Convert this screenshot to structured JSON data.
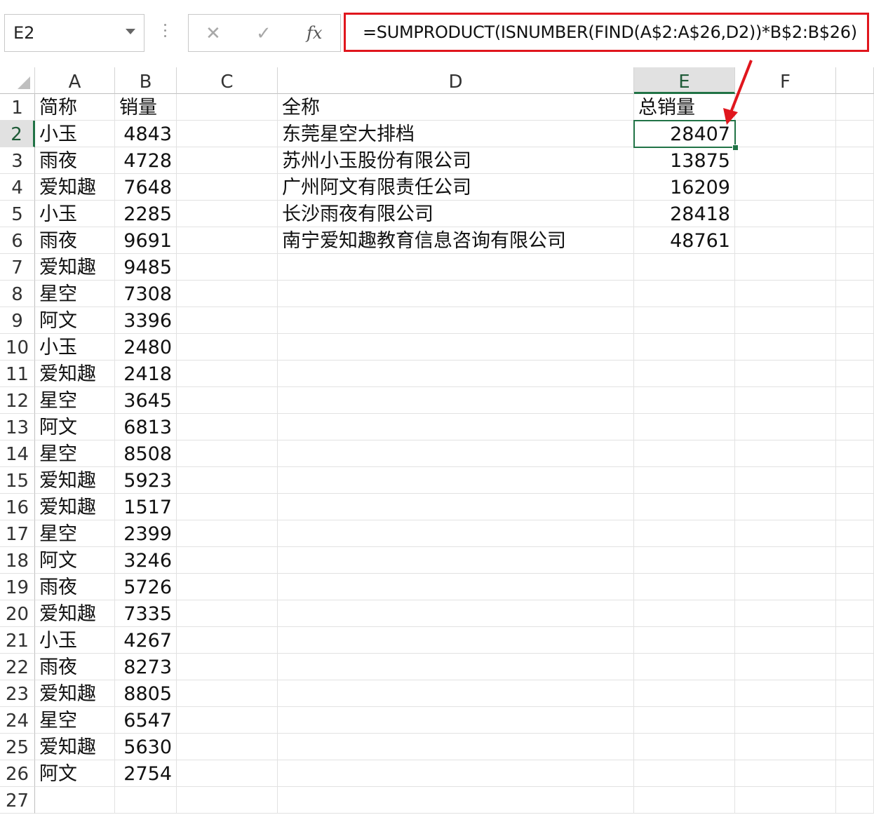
{
  "toolbar": {
    "name_box": "E2",
    "cancel_icon": "✕",
    "enter_icon": "✓",
    "function_icon": "fx",
    "formula": "=SUMPRODUCT(ISNUMBER(FIND(A$2:A$26,D2))*B$2:B$26)"
  },
  "columns": [
    "A",
    "B",
    "C",
    "D",
    "E",
    "F"
  ],
  "selected_cell": {
    "column": "E",
    "row": 2
  },
  "rows": [
    {
      "n": "1",
      "A": "简称",
      "B": "销量",
      "D": "全称",
      "E": "总销量"
    },
    {
      "n": "2",
      "A": "小玉",
      "B": "4843",
      "D": "东莞星空大排档",
      "E": "28407"
    },
    {
      "n": "3",
      "A": "雨夜",
      "B": "4728",
      "D": "苏州小玉股份有限公司",
      "E": "13875"
    },
    {
      "n": "4",
      "A": "爱知趣",
      "B": "7648",
      "D": "广州阿文有限责任公司",
      "E": "16209"
    },
    {
      "n": "5",
      "A": "小玉",
      "B": "2285",
      "D": "长沙雨夜有限公司",
      "E": "28418"
    },
    {
      "n": "6",
      "A": "雨夜",
      "B": "9691",
      "D": "南宁爱知趣教育信息咨询有限公司",
      "E": "48761"
    },
    {
      "n": "7",
      "A": "爱知趣",
      "B": "9485",
      "D": "",
      "E": ""
    },
    {
      "n": "8",
      "A": "星空",
      "B": "7308",
      "D": "",
      "E": ""
    },
    {
      "n": "9",
      "A": "阿文",
      "B": "3396",
      "D": "",
      "E": ""
    },
    {
      "n": "10",
      "A": "小玉",
      "B": "2480",
      "D": "",
      "E": ""
    },
    {
      "n": "11",
      "A": "爱知趣",
      "B": "2418",
      "D": "",
      "E": ""
    },
    {
      "n": "12",
      "A": "星空",
      "B": "3645",
      "D": "",
      "E": ""
    },
    {
      "n": "13",
      "A": "阿文",
      "B": "6813",
      "D": "",
      "E": ""
    },
    {
      "n": "14",
      "A": "星空",
      "B": "8508",
      "D": "",
      "E": ""
    },
    {
      "n": "15",
      "A": "爱知趣",
      "B": "5923",
      "D": "",
      "E": ""
    },
    {
      "n": "16",
      "A": "爱知趣",
      "B": "1517",
      "D": "",
      "E": ""
    },
    {
      "n": "17",
      "A": "星空",
      "B": "2399",
      "D": "",
      "E": ""
    },
    {
      "n": "18",
      "A": "阿文",
      "B": "3246",
      "D": "",
      "E": ""
    },
    {
      "n": "19",
      "A": "雨夜",
      "B": "5726",
      "D": "",
      "E": ""
    },
    {
      "n": "20",
      "A": "爱知趣",
      "B": "7335",
      "D": "",
      "E": ""
    },
    {
      "n": "21",
      "A": "小玉",
      "B": "4267",
      "D": "",
      "E": ""
    },
    {
      "n": "22",
      "A": "雨夜",
      "B": "8273",
      "D": "",
      "E": ""
    },
    {
      "n": "23",
      "A": "爱知趣",
      "B": "8805",
      "D": "",
      "E": ""
    },
    {
      "n": "24",
      "A": "星空",
      "B": "6547",
      "D": "",
      "E": ""
    },
    {
      "n": "25",
      "A": "爱知趣",
      "B": "5630",
      "D": "",
      "E": ""
    },
    {
      "n": "26",
      "A": "阿文",
      "B": "2754",
      "D": "",
      "E": ""
    },
    {
      "n": "27",
      "A": "",
      "B": "",
      "D": "",
      "E": ""
    }
  ],
  "colors": {
    "accent": "#217346",
    "highlight_border": "#e0161d",
    "header_selected": "#e1e1e1",
    "gridline": "#e2e2e2"
  }
}
